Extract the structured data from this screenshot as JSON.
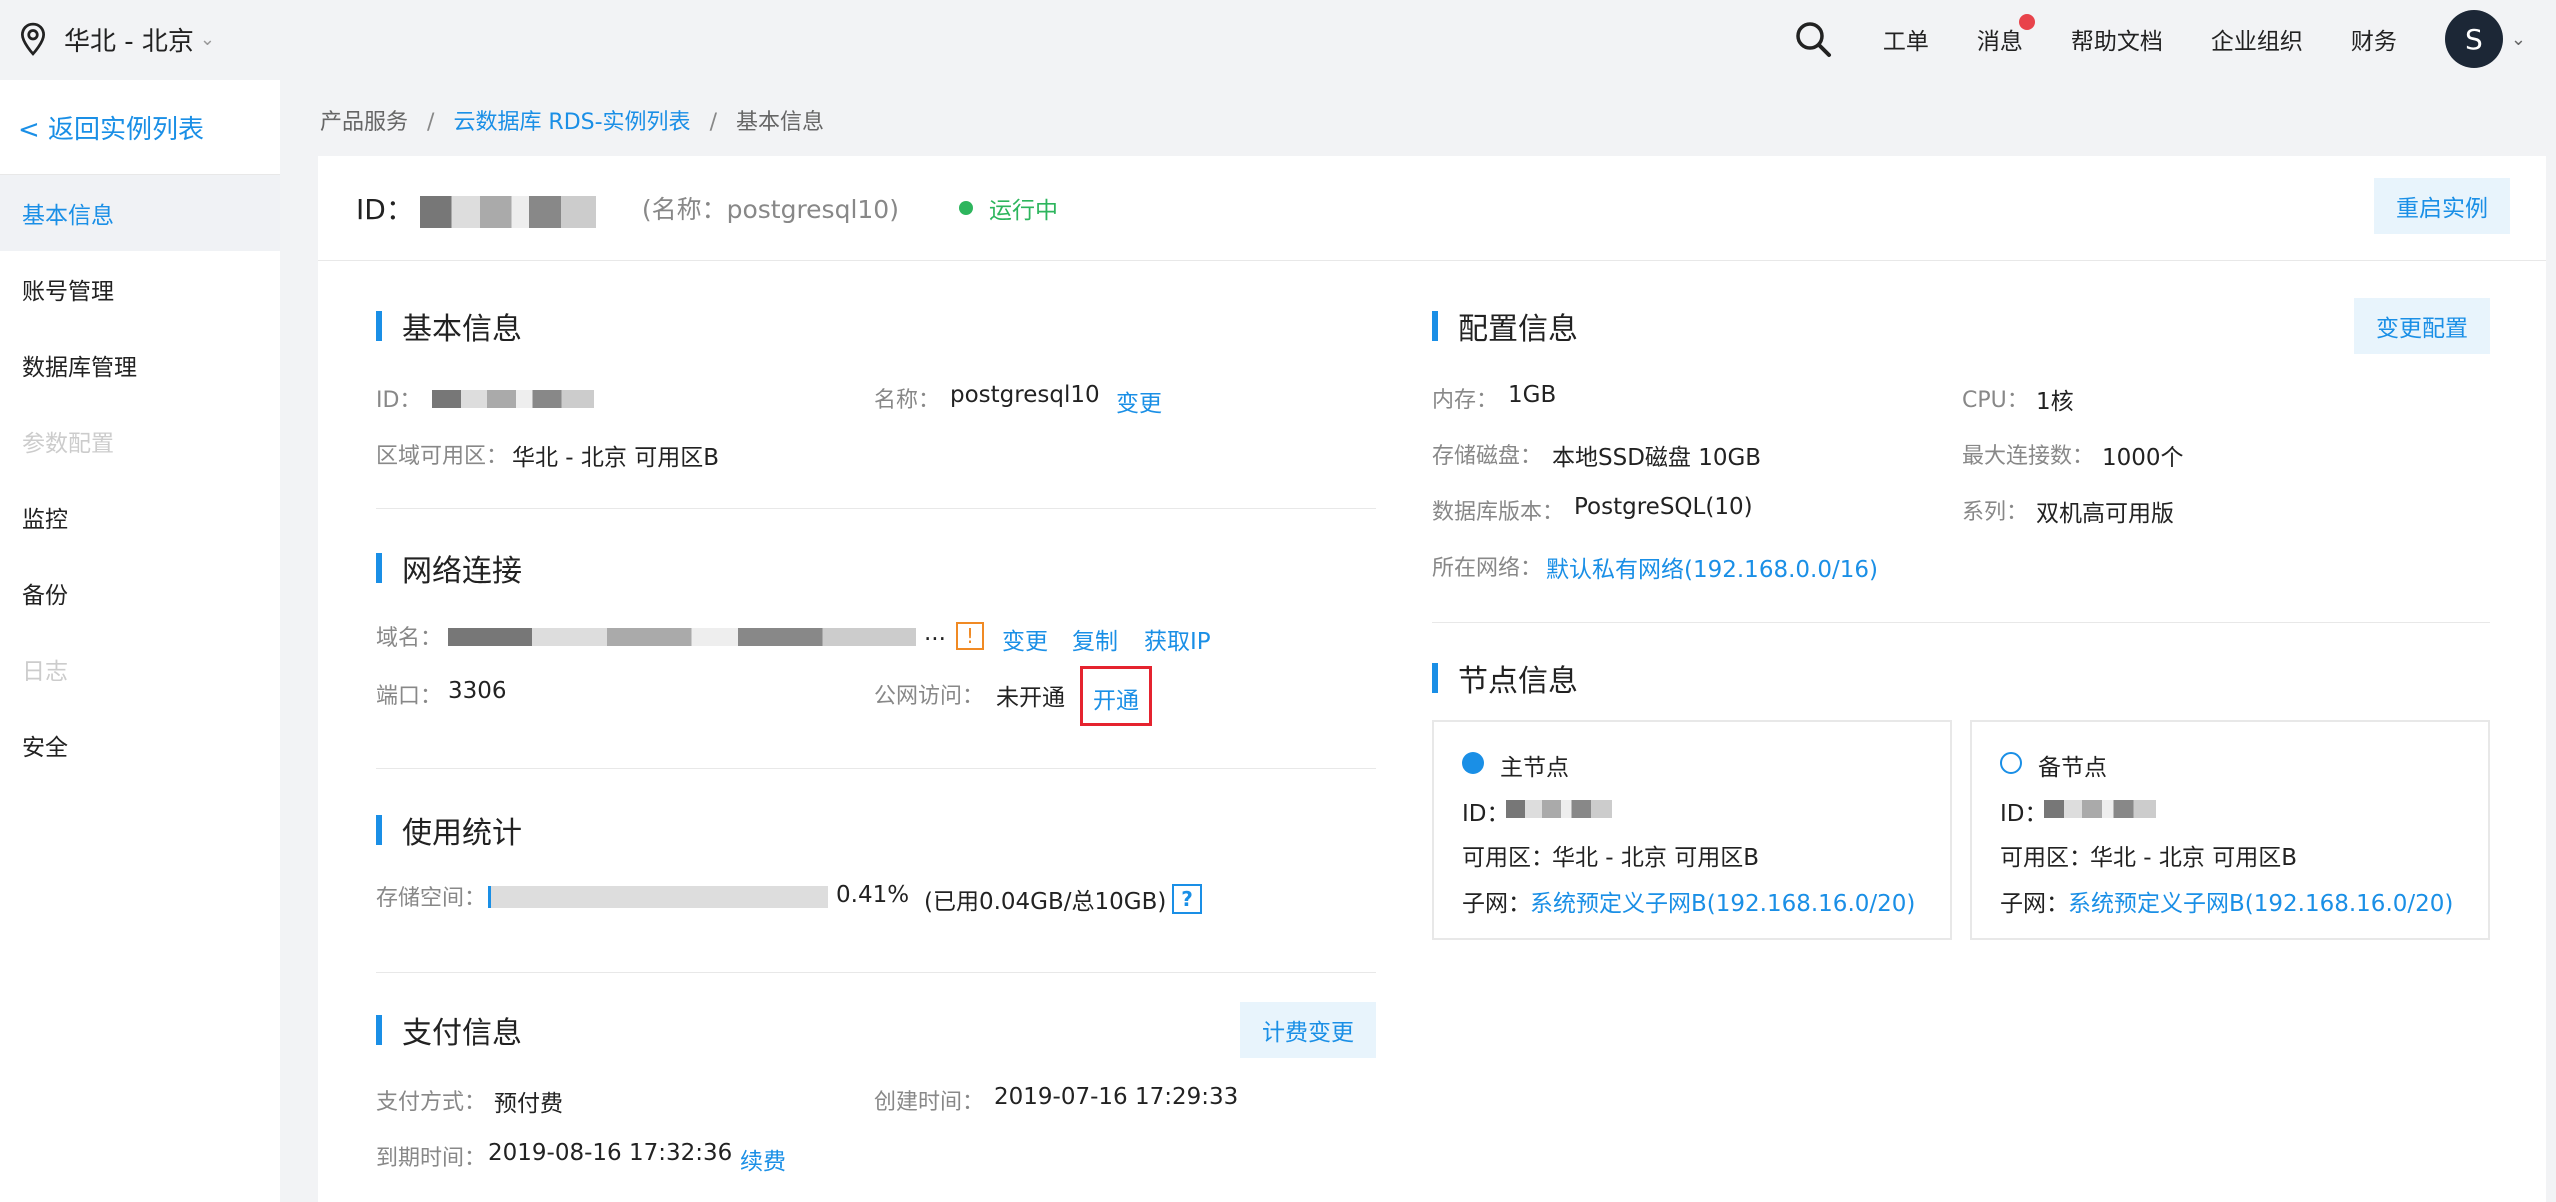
{
  "topbar": {
    "region": "华北 - 北京",
    "nav": [
      "工单",
      "消息",
      "帮助文档",
      "企业组织",
      "财务"
    ],
    "avatar_letter": "S"
  },
  "sidebar": {
    "back": "< 返回实例列表",
    "items": [
      {
        "label": "基本信息",
        "state": "active"
      },
      {
        "label": "账号管理",
        "state": "normal"
      },
      {
        "label": "数据库管理",
        "state": "normal"
      },
      {
        "label": "参数配置",
        "state": "disabled"
      },
      {
        "label": "监控",
        "state": "normal"
      },
      {
        "label": "备份",
        "state": "normal"
      },
      {
        "label": "日志",
        "state": "disabled"
      },
      {
        "label": "安全",
        "state": "normal"
      }
    ]
  },
  "breadcrumb": {
    "root": "产品服务",
    "list": "云数据库 RDS-实例列表",
    "current": "基本信息",
    "sep": "/"
  },
  "header": {
    "id_label": "ID：",
    "name_paren": "(名称：postgresql10)",
    "status": "运行中",
    "restart": "重启实例"
  },
  "basic": {
    "title": "基本信息",
    "id_label": "ID：",
    "name_label": "名称：",
    "name_value": "postgresql10",
    "change": "变更",
    "zone_label": "区域可用区：",
    "zone_value": "华北 - 北京 可用区B"
  },
  "network": {
    "title": "网络连接",
    "domain_label": "域名：",
    "ellipsis": "...",
    "warn": "!",
    "change": "变更",
    "copy": "复制",
    "get_ip": "获取IP",
    "port_label": "端口：",
    "port_value": "3306",
    "public_label": "公网访问：",
    "public_value": "未开通",
    "open": "开通"
  },
  "usage": {
    "title": "使用统计",
    "storage_label": "存储空间：",
    "percent": "0.41%",
    "progress": 0.0041,
    "detail": "(已用0.04GB/总10GB)",
    "help": "?"
  },
  "payment": {
    "title": "支付信息",
    "change_billing": "计费变更",
    "method_label": "支付方式：",
    "method_value": "预付费",
    "created_label": "创建时间：",
    "created_value": "2019-07-16 17:29:33",
    "expire_label": "到期时间：",
    "expire_value": "2019-08-16 17:32:36",
    "renew": "续费"
  },
  "config": {
    "title": "配置信息",
    "change": "变更配置",
    "mem_label": "内存：",
    "mem_value": "1GB",
    "cpu_label": "CPU：",
    "cpu_value": "1核",
    "disk_label": "存储磁盘：",
    "disk_value": "本地SSD磁盘 10GB",
    "maxconn_label": "最大连接数：",
    "maxconn_value": "1000个",
    "ver_label": "数据库版本：",
    "ver_value": "PostgreSQL(10)",
    "series_label": "系列：",
    "series_value": "双机高可用版",
    "net_label": "所在网络：",
    "net_value": "默认私有网络(192.168.0.0/16)"
  },
  "nodes": {
    "title": "节点信息",
    "primary": {
      "name": "主节点",
      "id_label": "ID：",
      "zone_label": "可用区：",
      "zone_value": "华北 - 北京 可用区B",
      "subnet_label": "子网：",
      "subnet_value": "系统预定义子网B(192.168.16.0/20)"
    },
    "standby": {
      "name": "备节点",
      "id_label": "ID：",
      "zone_label": "可用区：",
      "zone_value": "华北 - 北京 可用区B",
      "subnet_label": "子网：",
      "subnet_value": "系统预定义子网B(192.168.16.0/20)"
    }
  },
  "colors": {
    "accent": "#1a8fe6",
    "status_green": "#2db55d",
    "alert_red": "#e5232f",
    "warn_orange": "#f08a24"
  }
}
